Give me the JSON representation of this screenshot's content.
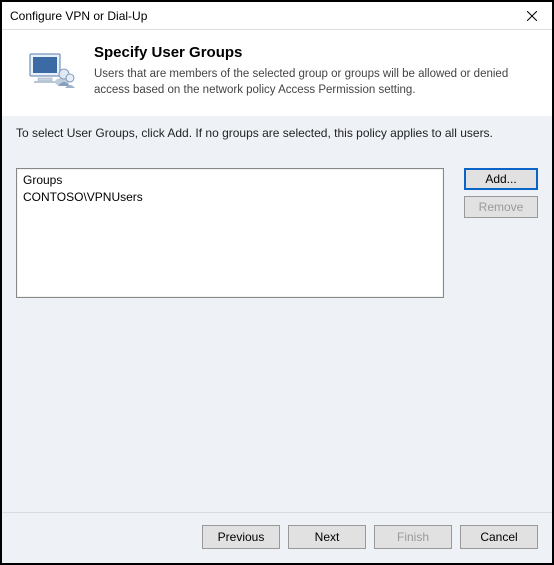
{
  "window": {
    "title": "Configure VPN or Dial-Up"
  },
  "header": {
    "heading": "Specify User Groups",
    "description": "Users that are members of the selected group or groups will be allowed or denied access based on the network policy Access Permission setting."
  },
  "instruction": "To select User Groups, click Add. If no groups are selected, this policy applies to all users.",
  "groupsList": {
    "header": "Groups",
    "items": [
      "CONTOSO\\VPNUsers"
    ]
  },
  "sideButtons": {
    "add": "Add...",
    "remove": "Remove"
  },
  "footer": {
    "previous": "Previous",
    "next": "Next",
    "finish": "Finish",
    "cancel": "Cancel"
  }
}
